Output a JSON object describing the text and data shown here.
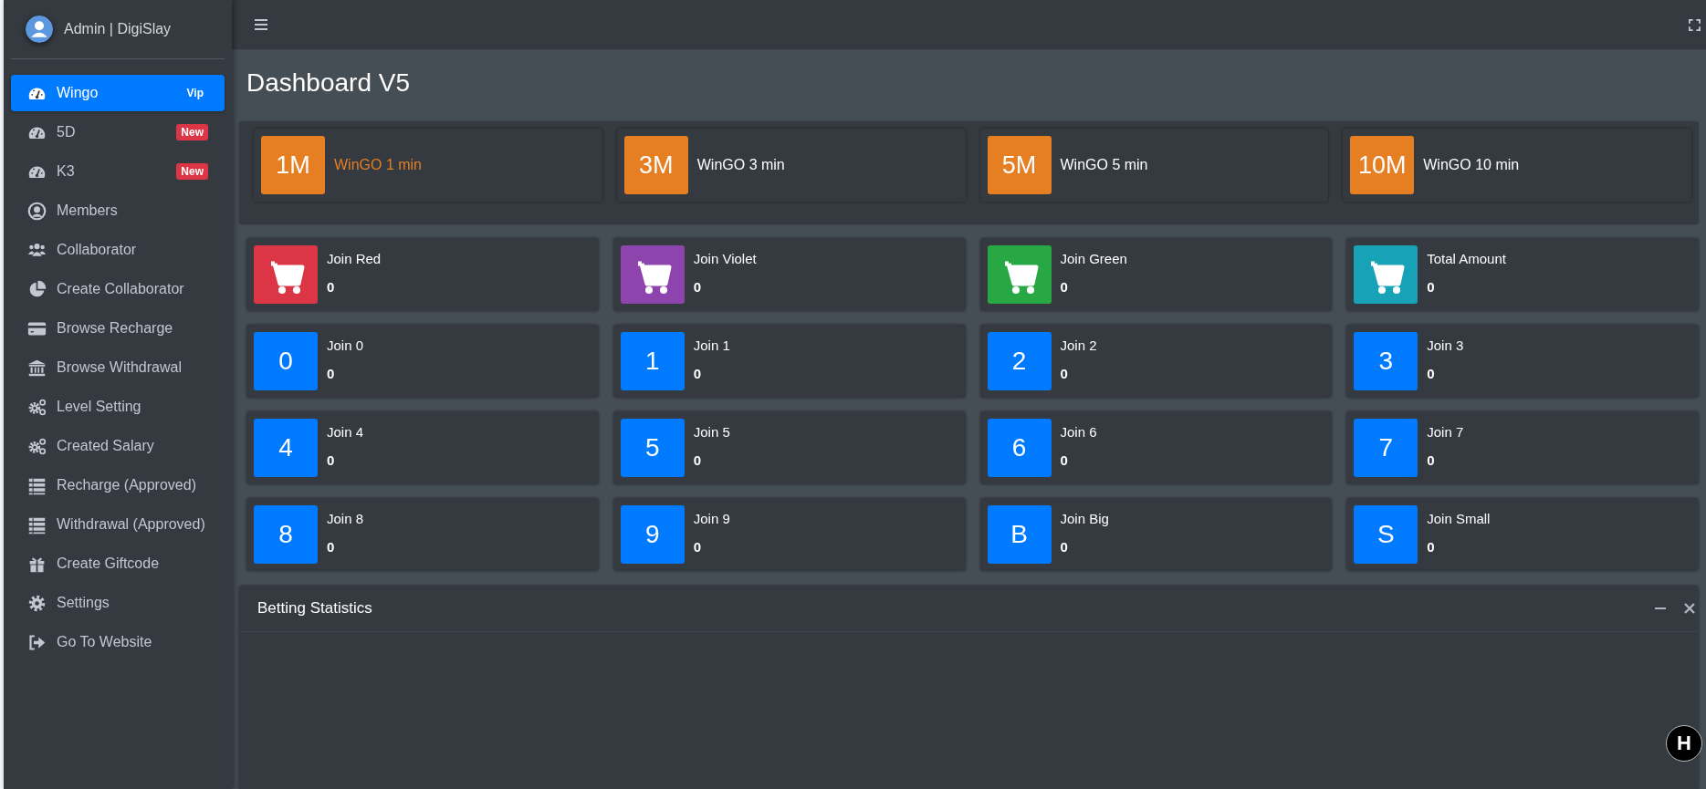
{
  "sidebar": {
    "brand": "Admin | DigiSlay",
    "items": [
      {
        "label": "Wingo",
        "selected": true,
        "badge": {
          "text": "Vip",
          "color": "#007bff"
        }
      },
      {
        "label": "5D",
        "selected": false,
        "badge": {
          "text": "New",
          "color": "#dc3545"
        }
      },
      {
        "label": "K3",
        "selected": false,
        "badge": {
          "text": "New",
          "color": "#dc3545"
        }
      },
      {
        "label": "Members",
        "selected": false
      },
      {
        "label": "Collaborator",
        "selected": false
      },
      {
        "label": "Create Collaborator",
        "selected": false
      },
      {
        "label": "Browse Recharge",
        "selected": false
      },
      {
        "label": "Browse Withdrawal",
        "selected": false
      },
      {
        "label": "Level Setting",
        "selected": false
      },
      {
        "label": "Created Salary",
        "selected": false
      },
      {
        "label": "Recharge (Approved)",
        "selected": false
      },
      {
        "label": "Withdrawal (Approved)",
        "selected": false
      },
      {
        "label": "Create Giftcode",
        "selected": false
      },
      {
        "label": "Settings",
        "selected": false
      },
      {
        "label": "Go To Website",
        "selected": false
      }
    ]
  },
  "page_title": "Dashboard V5",
  "games": [
    {
      "code": "1M",
      "label": "WinGO 1 min",
      "selected": true
    },
    {
      "code": "3M",
      "label": "WinGO 3 min",
      "selected": false
    },
    {
      "code": "5M",
      "label": "WinGO 5 min",
      "selected": false
    },
    {
      "code": "10M",
      "label": "WinGO 10 min",
      "selected": false
    }
  ],
  "cards": [
    {
      "kind": "cart",
      "color": "#dc3545",
      "label": "Join Red",
      "value": "0"
    },
    {
      "kind": "cart",
      "color": "#8e44ad",
      "label": "Join Violet",
      "value": "0"
    },
    {
      "kind": "cart",
      "color": "#28a745",
      "label": "Join Green",
      "value": "0"
    },
    {
      "kind": "cart",
      "color": "#17a2b8",
      "label": "Total Amount",
      "value": "0"
    },
    {
      "kind": "text",
      "symbol": "0",
      "label": "Join 0",
      "value": "0"
    },
    {
      "kind": "text",
      "symbol": "1",
      "label": "Join 1",
      "value": "0"
    },
    {
      "kind": "text",
      "symbol": "2",
      "label": "Join 2",
      "value": "0"
    },
    {
      "kind": "text",
      "symbol": "3",
      "label": "Join 3",
      "value": "0"
    },
    {
      "kind": "text",
      "symbol": "4",
      "label": "Join 4",
      "value": "0"
    },
    {
      "kind": "text",
      "symbol": "5",
      "label": "Join 5",
      "value": "0"
    },
    {
      "kind": "text",
      "symbol": "6",
      "label": "Join 6",
      "value": "0"
    },
    {
      "kind": "text",
      "symbol": "7",
      "label": "Join 7",
      "value": "0"
    },
    {
      "kind": "text",
      "symbol": "8",
      "label": "Join 8",
      "value": "0"
    },
    {
      "kind": "text",
      "symbol": "9",
      "label": "Join 9",
      "value": "0"
    },
    {
      "kind": "text",
      "symbol": "B",
      "label": "Join Big",
      "value": "0"
    },
    {
      "kind": "text",
      "symbol": "S",
      "label": "Join Small",
      "value": "0"
    }
  ],
  "betting_statistics": {
    "title": "Betting Statistics"
  },
  "floating_button": {
    "label": "H"
  }
}
